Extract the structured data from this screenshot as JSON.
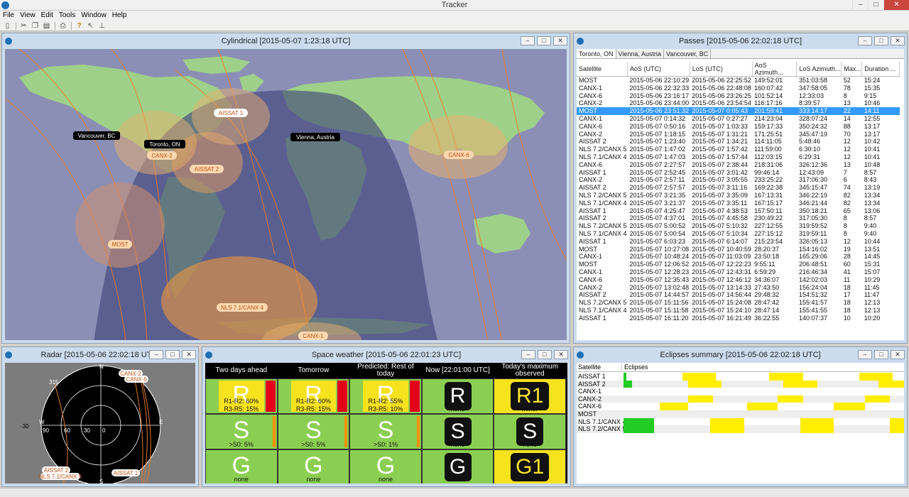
{
  "app": {
    "title": "Tracker"
  },
  "menu": [
    "File",
    "View",
    "Edit",
    "Tools",
    "Window",
    "Help"
  ],
  "toolbar": [
    "new-icon",
    "cut-icon",
    "copy-icon",
    "paste-icon",
    "print-icon",
    "help-icon",
    "pointer-icon",
    "pin-icon"
  ],
  "map": {
    "title": "Cylindrical [2015-05-07 1:23:18 UTC]",
    "sat_labels": [
      "AISSAT 1",
      "CANX-2",
      "AISSAT 2",
      "CANX-6",
      "MOST",
      "NLS 7.1/CANX 4",
      "CANX-1"
    ],
    "ground_labels": [
      "Vancouver, BC",
      "Toronto, ON",
      "Vienna, Austria"
    ]
  },
  "passes": {
    "title": "Passes [2015-05-06 22:02:18 UTC]",
    "tabs": [
      "Toronto, ON",
      "Vienna, Austria",
      "Vancouver, BC"
    ],
    "columns": [
      "Satellite",
      "AoS (UTC)",
      "LoS (UTC)",
      "AoS Azimuth...",
      "LoS Azimuth...",
      "Max...",
      "Duration ..."
    ],
    "rows": [
      [
        "MOST",
        "2015-05-06 22:10:29",
        "2015-05-06 22:25:52",
        "149:52:01",
        "351:03:58",
        "52",
        "15:24"
      ],
      [
        "CANX-1",
        "2015-05-06 22:32:33",
        "2015-05-06 22:48:08",
        "160:07:42",
        "347:58:05",
        "78",
        "15:35"
      ],
      [
        "CANX-6",
        "2015-05-06 23:16:17",
        "2015-05-06 23:26:25",
        "101:52:14",
        "12:33:03",
        "8",
        "9:15"
      ],
      [
        "CANX-2",
        "2015-05-06 23:44:00",
        "2015-05-06 23:54:54",
        "116:17:16",
        "8:39:57",
        "13",
        "10:46"
      ],
      [
        "MOST",
        "2015-05-06 23:51:32",
        "2015-05-07 0:05:43",
        "201:59:41",
        "333:14:17",
        "22",
        "14:11"
      ],
      [
        "CANX-1",
        "2015-05-07 0:14:32",
        "2015-05-07 0:27:27",
        "214:23:04",
        "328:07:24",
        "14",
        "12:55"
      ],
      [
        "CANX-6",
        "2015-05-07 0:50:16",
        "2015-05-07 1:03:33",
        "159:17:33",
        "350:24:32",
        "88",
        "13:17"
      ],
      [
        "CANX-2",
        "2015-05-07 1:18:15",
        "2015-05-07 1:31:21",
        "171:25:51",
        "345:47:19",
        "70",
        "13:17"
      ],
      [
        "AISSAT 2",
        "2015-05-07 1:23:40",
        "2015-05-07 1:34:21",
        "114:11:05",
        "5:48:46",
        "12",
        "10:42"
      ],
      [
        "NLS 7.2/CANX 5",
        "2015-05-07 1:47:02",
        "2015-05-07 1:57:42",
        "111:59:00",
        "6:30:10",
        "12",
        "10:41"
      ],
      [
        "NLS 7.1/CANX 4",
        "2015-05-07 1:47:03",
        "2015-05-07 1:57:44",
        "112:03:15",
        "6:29:31",
        "12",
        "10:41"
      ],
      [
        "CANX-6",
        "2015-05-07 2:27:57",
        "2015-05-07 2:38:44",
        "218:31:06",
        "326:12:36",
        "13",
        "10:48"
      ],
      [
        "AISSAT 1",
        "2015-05-07 2:52:45",
        "2015-05-07 3:01:42",
        "99:46:14",
        "12:43:09",
        "7",
        "8:57"
      ],
      [
        "CANX-2",
        "2015-05-07 2:57:11",
        "2015-05-07 3:05:55",
        "233:25:22",
        "317:06:30",
        "6",
        "8:43"
      ],
      [
        "AISSAT 2",
        "2015-05-07 2:57:57",
        "2015-05-07 3:11:16",
        "169:22:38",
        "345:15:47",
        "74",
        "13:19"
      ],
      [
        "NLS 7.2/CANX 5",
        "2015-05-07 3:21:35",
        "2015-05-07 3:35:09",
        "167:13:31",
        "346:22:19",
        "82",
        "13:34"
      ],
      [
        "NLS 7.1/CANX 4",
        "2015-05-07 3:21:37",
        "2015-05-07 3:35:11",
        "167:15:17",
        "346:21:44",
        "82",
        "13:34"
      ],
      [
        "AISSAT 1",
        "2015-05-07 4:25:47",
        "2015-05-07 4:38:53",
        "157:50:11",
        "350:18:21",
        "65",
        "13:06"
      ],
      [
        "AISSAT 2",
        "2015-05-07 4:37:01",
        "2015-05-07 4:45:58",
        "230:49:22",
        "317:05:30",
        "8",
        "8:57"
      ],
      [
        "NLS 7.2/CANX 5",
        "2015-05-07 5:00:52",
        "2015-05-07 5:10:32",
        "227:12:55",
        "319:59:52",
        "8",
        "9:40"
      ],
      [
        "NLS 7.1/CANX 4",
        "2015-05-07 5:00:54",
        "2015-05-07 5:10:34",
        "227:15:12",
        "319:59:11",
        "8",
        "9:40"
      ],
      [
        "AISSAT 1",
        "2015-05-07 6:03:23",
        "2015-05-07 6:14:07",
        "215:23:54",
        "326:05:13",
        "12",
        "10:44"
      ],
      [
        "MOST",
        "2015-05-07 10:27:08",
        "2015-05-07 10:40:59",
        "28:20:37",
        "154:16:02",
        "19",
        "13:51"
      ],
      [
        "CANX-1",
        "2015-05-07 10:48:24",
        "2015-05-07 11:03:09",
        "23:50:18",
        "165:29:06",
        "28",
        "14:45"
      ],
      [
        "MOST",
        "2015-05-07 12:06:52",
        "2015-05-07 12:22:23",
        "9:55:11",
        "206:48:51",
        "60",
        "15:31"
      ],
      [
        "CANX-1",
        "2015-05-07 12:28:23",
        "2015-05-07 12:43:31",
        "6:59:29",
        "216:46:34",
        "41",
        "15:07"
      ],
      [
        "CANX-6",
        "2015-05-07 12:35:43",
        "2015-05-07 12:46:12",
        "34:36:07",
        "142:02:03",
        "11",
        "10:29"
      ],
      [
        "CANX-2",
        "2015-05-07 13:02:48",
        "2015-05-07 13:14:33",
        "27:43:50",
        "156:24:04",
        "18",
        "11:45"
      ],
      [
        "AISSAT 2",
        "2015-05-07 14:44:57",
        "2015-05-07 14:56:44",
        "29:48:32",
        "154:51:32",
        "17",
        "11:47"
      ],
      [
        "NLS 7.2/CANX 5",
        "2015-05-07 15:11:56",
        "2015-05-07 15:24:08",
        "28:47:42",
        "155:41:57",
        "18",
        "12:13"
      ],
      [
        "NLS 7.1/CANX 4",
        "2015-05-07 15:11:58",
        "2015-05-07 15:24:10",
        "28:47:14",
        "155:41:55",
        "18",
        "12:13"
      ],
      [
        "AISSAT 1",
        "2015-05-07 16:11:20",
        "2015-05-07 16:21:49",
        "36:22:55",
        "140:07:37",
        "10",
        "10:20"
      ]
    ],
    "selected_row": 4
  },
  "radar": {
    "title": "Radar [2015-05-06 22:02:18 UTC]",
    "labels": [
      "N",
      "E",
      "S",
      "W",
      "0",
      "30",
      "60",
      "90",
      "-30",
      "315",
      "CANX-2",
      "CANX-6",
      "AISSAT 2",
      "NLS 7.1/CANX 5",
      "AISSAT 1"
    ]
  },
  "space_weather": {
    "title": "Space weather [2015-05-06 22:01:23 UTC]",
    "headers": [
      "Two days ahead",
      "Tomorrow",
      "Predicted: Rest of today",
      "Now [22:01:00 UTC]",
      "Today's maximum observed"
    ],
    "r_row": [
      {
        "big": "R",
        "line1": "R1-R2: 60%",
        "line2": "R3-R5: 15%",
        "type": "prob"
      },
      {
        "big": "R",
        "line1": "R1-R2: 60%",
        "line2": "R3-R5: 15%",
        "type": "prob"
      },
      {
        "big": "R",
        "line1": "R1-R2: 55%",
        "line2": "R3-R5: 10%",
        "type": "prob"
      },
      {
        "big": "R",
        "sub": "none",
        "type": "box"
      },
      {
        "big": "R1",
        "sub": "minor",
        "type": "boxy"
      }
    ],
    "s_row": [
      {
        "big": "S",
        "sub": ">S0: 5%",
        "type": "plain"
      },
      {
        "big": "S",
        "sub": ">S0: 5%",
        "type": "plain"
      },
      {
        "big": "S",
        "sub": ">S0: 1%",
        "type": "plain"
      },
      {
        "big": "S",
        "sub": "none",
        "type": "box"
      },
      {
        "big": "S",
        "sub": "none",
        "type": "box"
      }
    ],
    "g_row": [
      {
        "big": "G",
        "sub": "none",
        "type": "plain"
      },
      {
        "big": "G",
        "sub": "none",
        "type": "plain"
      },
      {
        "big": "G",
        "sub": "none",
        "type": "plain"
      },
      {
        "big": "G",
        "sub": "none",
        "type": "box"
      },
      {
        "big": "G1",
        "sub": "minor",
        "type": "boxy"
      }
    ],
    "colors": {
      "green": "#8bcf52",
      "yellow": "#f7e21e",
      "red": "#e3001b",
      "orange": "#f39200"
    }
  },
  "eclipses": {
    "title": "Eclipses summary [2015-05-06 22:02:18 UTC]",
    "columns": [
      "Satellite",
      "Eclipses"
    ],
    "rows": [
      {
        "name": "AISSAT 1",
        "segs": [
          [
            0.0,
            0.01,
            "#22cc22"
          ],
          [
            0.21,
            0.33,
            "#ffee00"
          ],
          [
            0.52,
            0.64,
            "#ffee00"
          ],
          [
            0.84,
            0.96,
            "#ffee00"
          ]
        ]
      },
      {
        "name": "AISSAT 2",
        "segs": [
          [
            0.0,
            0.03,
            "#22cc22"
          ],
          [
            0.23,
            0.35,
            "#ffee00"
          ],
          [
            0.57,
            0.69,
            "#ffee00"
          ],
          [
            0.91,
            1.0,
            "#ffee00"
          ]
        ]
      },
      {
        "name": "CANX-1",
        "segs": []
      },
      {
        "name": "CANX-2",
        "segs": [
          [
            0.23,
            0.32,
            "#ffee00"
          ],
          [
            0.55,
            0.64,
            "#ffee00"
          ],
          [
            0.86,
            0.95,
            "#ffee00"
          ]
        ]
      },
      {
        "name": "CANX-6",
        "segs": [
          [
            0.13,
            0.23,
            "#ffee00"
          ],
          [
            0.44,
            0.55,
            "#ffee00"
          ],
          [
            0.75,
            0.86,
            "#ffee00"
          ]
        ]
      },
      {
        "name": "MOST",
        "segs": []
      },
      {
        "name": "NLS 7.1/CANX 4",
        "segs": [
          [
            0.0,
            0.11,
            "#22cc22"
          ],
          [
            0.31,
            0.43,
            "#ffee00"
          ],
          [
            0.63,
            0.75,
            "#ffee00"
          ],
          [
            0.95,
            1.0,
            "#ffee00"
          ]
        ]
      },
      {
        "name": "NLS 7.2/CANX 5",
        "segs": [
          [
            0.0,
            0.11,
            "#22cc22"
          ],
          [
            0.31,
            0.43,
            "#ffee00"
          ],
          [
            0.63,
            0.75,
            "#ffee00"
          ],
          [
            0.95,
            1.0,
            "#ffee00"
          ]
        ]
      }
    ]
  }
}
